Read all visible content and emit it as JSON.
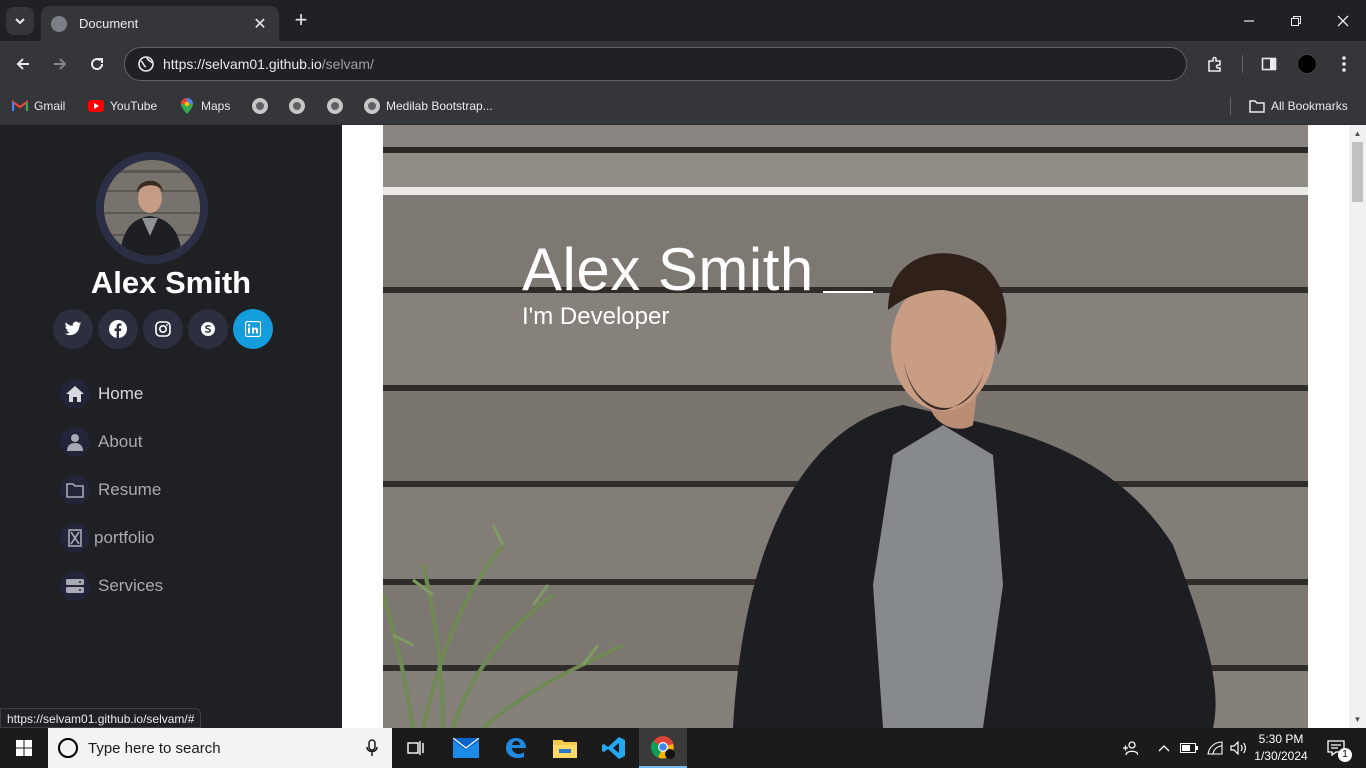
{
  "browser": {
    "tab_title": "Document",
    "url_host": "https://selvam01.github.io",
    "url_path": "/selvam/",
    "bookmarks": [
      {
        "label": "Gmail",
        "icon": "gmail-icon"
      },
      {
        "label": "YouTube",
        "icon": "youtube-icon"
      },
      {
        "label": "Maps",
        "icon": "maps-icon"
      },
      {
        "label": "",
        "icon": "globe-icon"
      },
      {
        "label": "",
        "icon": "globe-icon"
      },
      {
        "label": "",
        "icon": "globe-icon"
      },
      {
        "label": "Medilab Bootstrap...",
        "icon": "globe-icon"
      }
    ],
    "all_bookmarks": "All Bookmarks",
    "status_url": "https://selvam01.github.io/selvam/#"
  },
  "sidebar": {
    "name": "Alex Smith",
    "socials": [
      "twitter",
      "facebook",
      "instagram",
      "skype",
      "linkedin"
    ],
    "active_social": "linkedin",
    "nav": [
      {
        "label": "Home",
        "icon": "home-icon"
      },
      {
        "label": "About",
        "icon": "user-icon"
      },
      {
        "label": "Resume",
        "icon": "folder-icon"
      },
      {
        "label": "portfolio",
        "icon": "portfolio-icon"
      },
      {
        "label": "Services",
        "icon": "server-icon"
      }
    ]
  },
  "hero": {
    "title": "Alex Smith",
    "subtitle": "I'm Developer"
  },
  "taskbar": {
    "search_placeholder": "Type here to search",
    "time": "5:30 PM",
    "date": "1/30/2024",
    "notification_count": "1"
  },
  "colors": {
    "accent": "#149ddd",
    "sidebar_bg": "#1f2023",
    "chrome_bg": "#35363a"
  }
}
